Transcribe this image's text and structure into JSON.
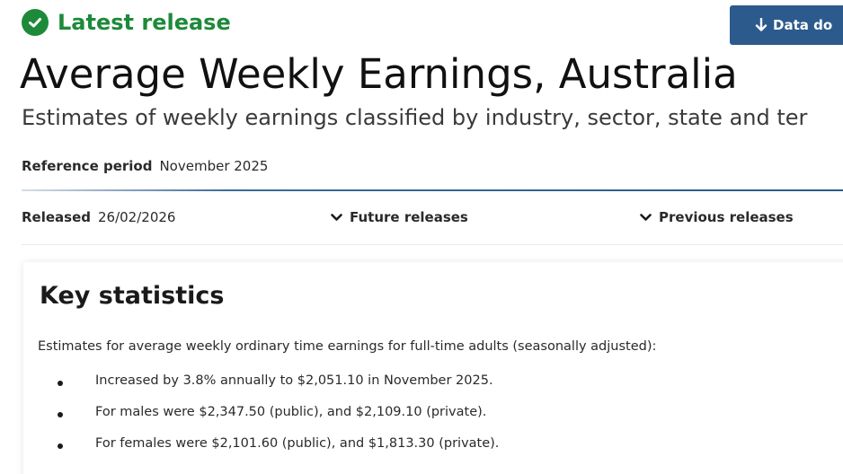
{
  "badge": {
    "label": "Latest release",
    "icon": "check-circle-icon",
    "color": "#1d8a3a"
  },
  "download_button": {
    "label": "Data do",
    "icon": "download-arrow-icon",
    "color": "#2c5a8c"
  },
  "title": "Average Weekly Earnings, Australia",
  "subtitle": "Estimates of weekly earnings classified by industry, sector, state and ter",
  "reference_period": {
    "label": "Reference period",
    "value": "November 2025"
  },
  "released": {
    "label": "Released",
    "value": "26/02/2026"
  },
  "toggles": {
    "future": "Future releases",
    "previous": "Previous releases",
    "icon": "chevron-down-icon"
  },
  "key_statistics": {
    "heading": "Key statistics",
    "intro": "Estimates for average weekly ordinary time earnings for full-time adults (seasonally adjusted):",
    "bullets": [
      "Increased by 3.8% annually to $2,051.10 in November 2025.",
      "For males were $2,347.50 (public), and $2,109.10 (private).",
      "For females were $2,101.60 (public), and $1,813.30 (private)."
    ]
  }
}
